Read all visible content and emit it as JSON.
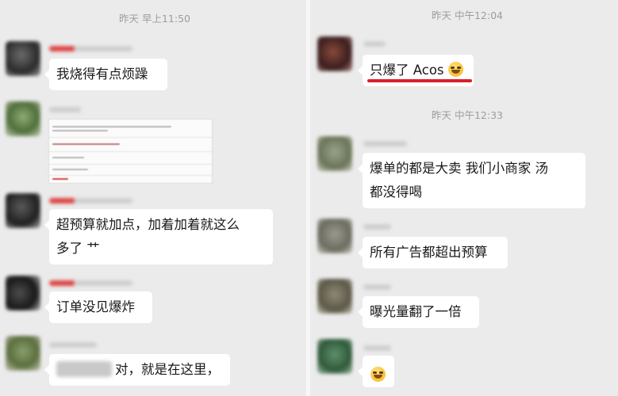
{
  "left_panel": {
    "timestamp": "昨天 早上11:50",
    "messages": [
      {
        "text": "我烧得有点烦躁"
      },
      {
        "type": "document"
      },
      {
        "line1": "超预算就加点，加着加着就这么",
        "line2": "多了 艹"
      },
      {
        "text": "订单没见爆炸"
      },
      {
        "text": "对，就是在这里，"
      }
    ]
  },
  "right_panel": {
    "timestamp1": "昨天 中午12:04",
    "timestamp2": "昨天 中午12:33",
    "messages": [
      {
        "text": "只爆了 Acos",
        "emoji": "laughing-with-tears-emoji",
        "underline_color": "#d8212a"
      },
      {
        "line1": "爆单的都是大卖  我们小商家  汤",
        "line2": "都没得喝"
      },
      {
        "text": "所有广告都超出预算"
      },
      {
        "text": "曝光量翻了一倍"
      },
      {
        "emoji": "laughing-with-tears-emoji"
      }
    ]
  },
  "colors": {
    "background": "#ebebeb",
    "bubble": "#ffffff",
    "timestamp": "#9d9d9d",
    "highlight_underline": "#d8212a"
  }
}
